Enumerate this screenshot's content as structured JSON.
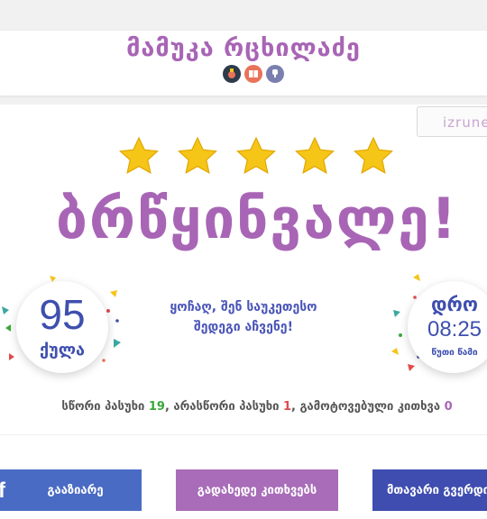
{
  "header": {
    "name": "მამუკა რცხილაძე",
    "badges": [
      "medal-badge-icon",
      "book-badge-icon",
      "trophy-badge-icon"
    ]
  },
  "lang_button": {
    "label": "izrune"
  },
  "rating": {
    "stars": 5,
    "max_stars": 5,
    "title": "ბრწყინვალე!"
  },
  "score": {
    "value": "95",
    "label": "ქულა"
  },
  "message": {
    "line1": "ყოჩაღ, შენ საუკეთესო",
    "line2": "შედეგი აჩვენე!"
  },
  "time": {
    "label": "დრო",
    "value": "08:25",
    "unit": "წუთი წამი"
  },
  "stats": {
    "correct_label": "სწორი პასუხი",
    "correct": "19",
    "wrong_label": "არასწორი პასუხი",
    "wrong": "1",
    "skipped_label": "გამოტოვებული კითხვა",
    "skipped": "0"
  },
  "buttons": {
    "share": "გააზიარე",
    "share_icon_glyph": "f",
    "review": "გადახედე კითხვებს",
    "home": "მთავარი გვერდი"
  },
  "colors": {
    "accent": "#a865b5",
    "primary": "#3e4fae",
    "star": "#f5c518"
  }
}
